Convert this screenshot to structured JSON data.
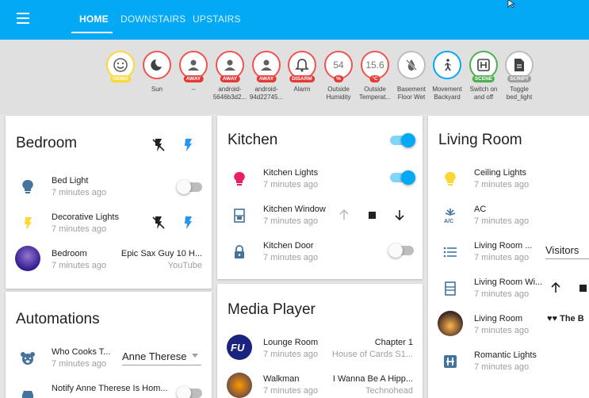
{
  "header": {
    "tabs": [
      {
        "label": "HOME"
      },
      {
        "label": "DOWNSTAIRS"
      },
      {
        "label": "UPSTAIRS"
      }
    ]
  },
  "badges": [
    {
      "value": "",
      "tag": "DEMO",
      "label": "",
      "icon": "smiley-icon"
    },
    {
      "value": "",
      "tag": "",
      "label": "Sun",
      "icon": "moon-icon"
    },
    {
      "value": "",
      "tag": "AWAY",
      "label": "--",
      "icon": "person-icon"
    },
    {
      "value": "",
      "tag": "AWAY",
      "label": "android-5646b3d2...",
      "icon": "person-icon"
    },
    {
      "value": "",
      "tag": "AWAY",
      "label": "android-94d22745...",
      "icon": "person-icon"
    },
    {
      "value": "",
      "tag": "DISARM",
      "label": "Alarm",
      "icon": "bell-icon"
    },
    {
      "value": "54",
      "tag": "%",
      "label": "Outside Humidity",
      "icon": ""
    },
    {
      "value": "15.6",
      "tag": "°C",
      "label": "Outside Temperat...",
      "icon": ""
    },
    {
      "value": "",
      "tag": "",
      "label": "Basement Floor Wet",
      "icon": "water-off-icon"
    },
    {
      "value": "",
      "tag": "",
      "label": "Movement Backyard",
      "icon": "walk-icon"
    },
    {
      "value": "",
      "tag": "SCENE",
      "label": "Switch on and off",
      "icon": "scene-icon"
    },
    {
      "value": "",
      "tag": "SCRIPT",
      "label": "Toggle bed_light",
      "icon": "script-icon"
    }
  ],
  "bedroom": {
    "title": "Bedroom",
    "rows": [
      {
        "name": "Bed Light",
        "sub": "7 minutes ago"
      },
      {
        "name": "Decorative Lights",
        "sub": "7 minutes ago"
      },
      {
        "name": "Bedroom",
        "sub": "7 minutes ago",
        "right": "Epic Sax Guy 10 H...",
        "right_sub": "YouTube"
      }
    ]
  },
  "automations": {
    "title": "Automations",
    "rows": [
      {
        "name": "Who Cooks T...",
        "sub": "7 minutes ago",
        "select": "Anne Therese"
      },
      {
        "name": "Notify Anne Therese Is Hom...",
        "sub": ""
      }
    ]
  },
  "kitchen": {
    "title": "Kitchen",
    "rows": [
      {
        "name": "Kitchen Lights",
        "sub": "7 minutes ago"
      },
      {
        "name": "Kitchen Window",
        "sub": "7 minutes ago"
      },
      {
        "name": "Kitchen Door",
        "sub": "7 minutes ago"
      }
    ]
  },
  "media": {
    "title": "Media Player",
    "rows": [
      {
        "name": "Lounge Room",
        "sub": "7 minutes ago",
        "right": "Chapter 1",
        "right_sub": "House of Cards S1..."
      },
      {
        "name": "Walkman",
        "sub": "7 minutes ago",
        "right": "I Wanna Be A Hipp...",
        "right_sub": "Technohead"
      }
    ]
  },
  "living": {
    "title": "Living Room",
    "rows": [
      {
        "name": "Ceiling Lights",
        "sub": "7 minutes ago"
      },
      {
        "name": "AC",
        "sub": "7 minutes ago"
      },
      {
        "name": "Living Room ...",
        "sub": "7 minutes ago",
        "select": "Visitors"
      },
      {
        "name": "Living Room Wi...",
        "sub": "7 minutes ago"
      },
      {
        "name": "Living Room",
        "sub": "7 minutes ago",
        "right": "♥♥ The B"
      },
      {
        "name": "Romantic Lights",
        "sub": "7 minutes ago"
      }
    ]
  },
  "colors": {
    "primary": "#03a9f4",
    "bulb_yellow": "#fdd835",
    "bulb_pink": "#e91e63",
    "icon_blue": "#44739e"
  }
}
